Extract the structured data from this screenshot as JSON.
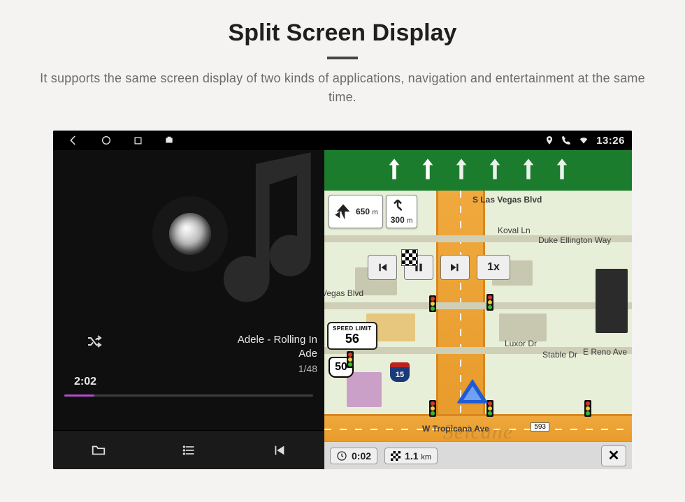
{
  "header": {
    "title": "Split Screen Display",
    "subtitle": "It supports the same screen display of two kinds of applications, navigation and entertainment at the same time."
  },
  "sysbar": {
    "time": "13:26"
  },
  "music": {
    "track_line1": "Adele - Rolling In",
    "track_line2": "Ade",
    "index": "1/48",
    "elapsed": "2:02"
  },
  "nav": {
    "street_top": "S Las Vegas Blvd",
    "street_east": "E Reno Ave",
    "street_bottom": "W Tropicana Ave",
    "street_koval": "Koval Ln",
    "street_duke": "Duke Ellington Way",
    "street_luxor": "Luxor Dr",
    "street_stable": "Stable Dr",
    "label_vegas": "Vegas Blvd",
    "turn_primary": "650",
    "turn_primary_unit": "m",
    "turn_alt": "300",
    "turn_alt_unit": "m",
    "playback_speed": "1x",
    "speed_limit_label": "SPEED LIMIT",
    "speed_limit_value": "56",
    "route_shield": "50",
    "interstate": "15",
    "exit": "593",
    "eta": "0:02",
    "dist": "1.1",
    "dist_unit": "km",
    "watermark": "Seicane"
  }
}
